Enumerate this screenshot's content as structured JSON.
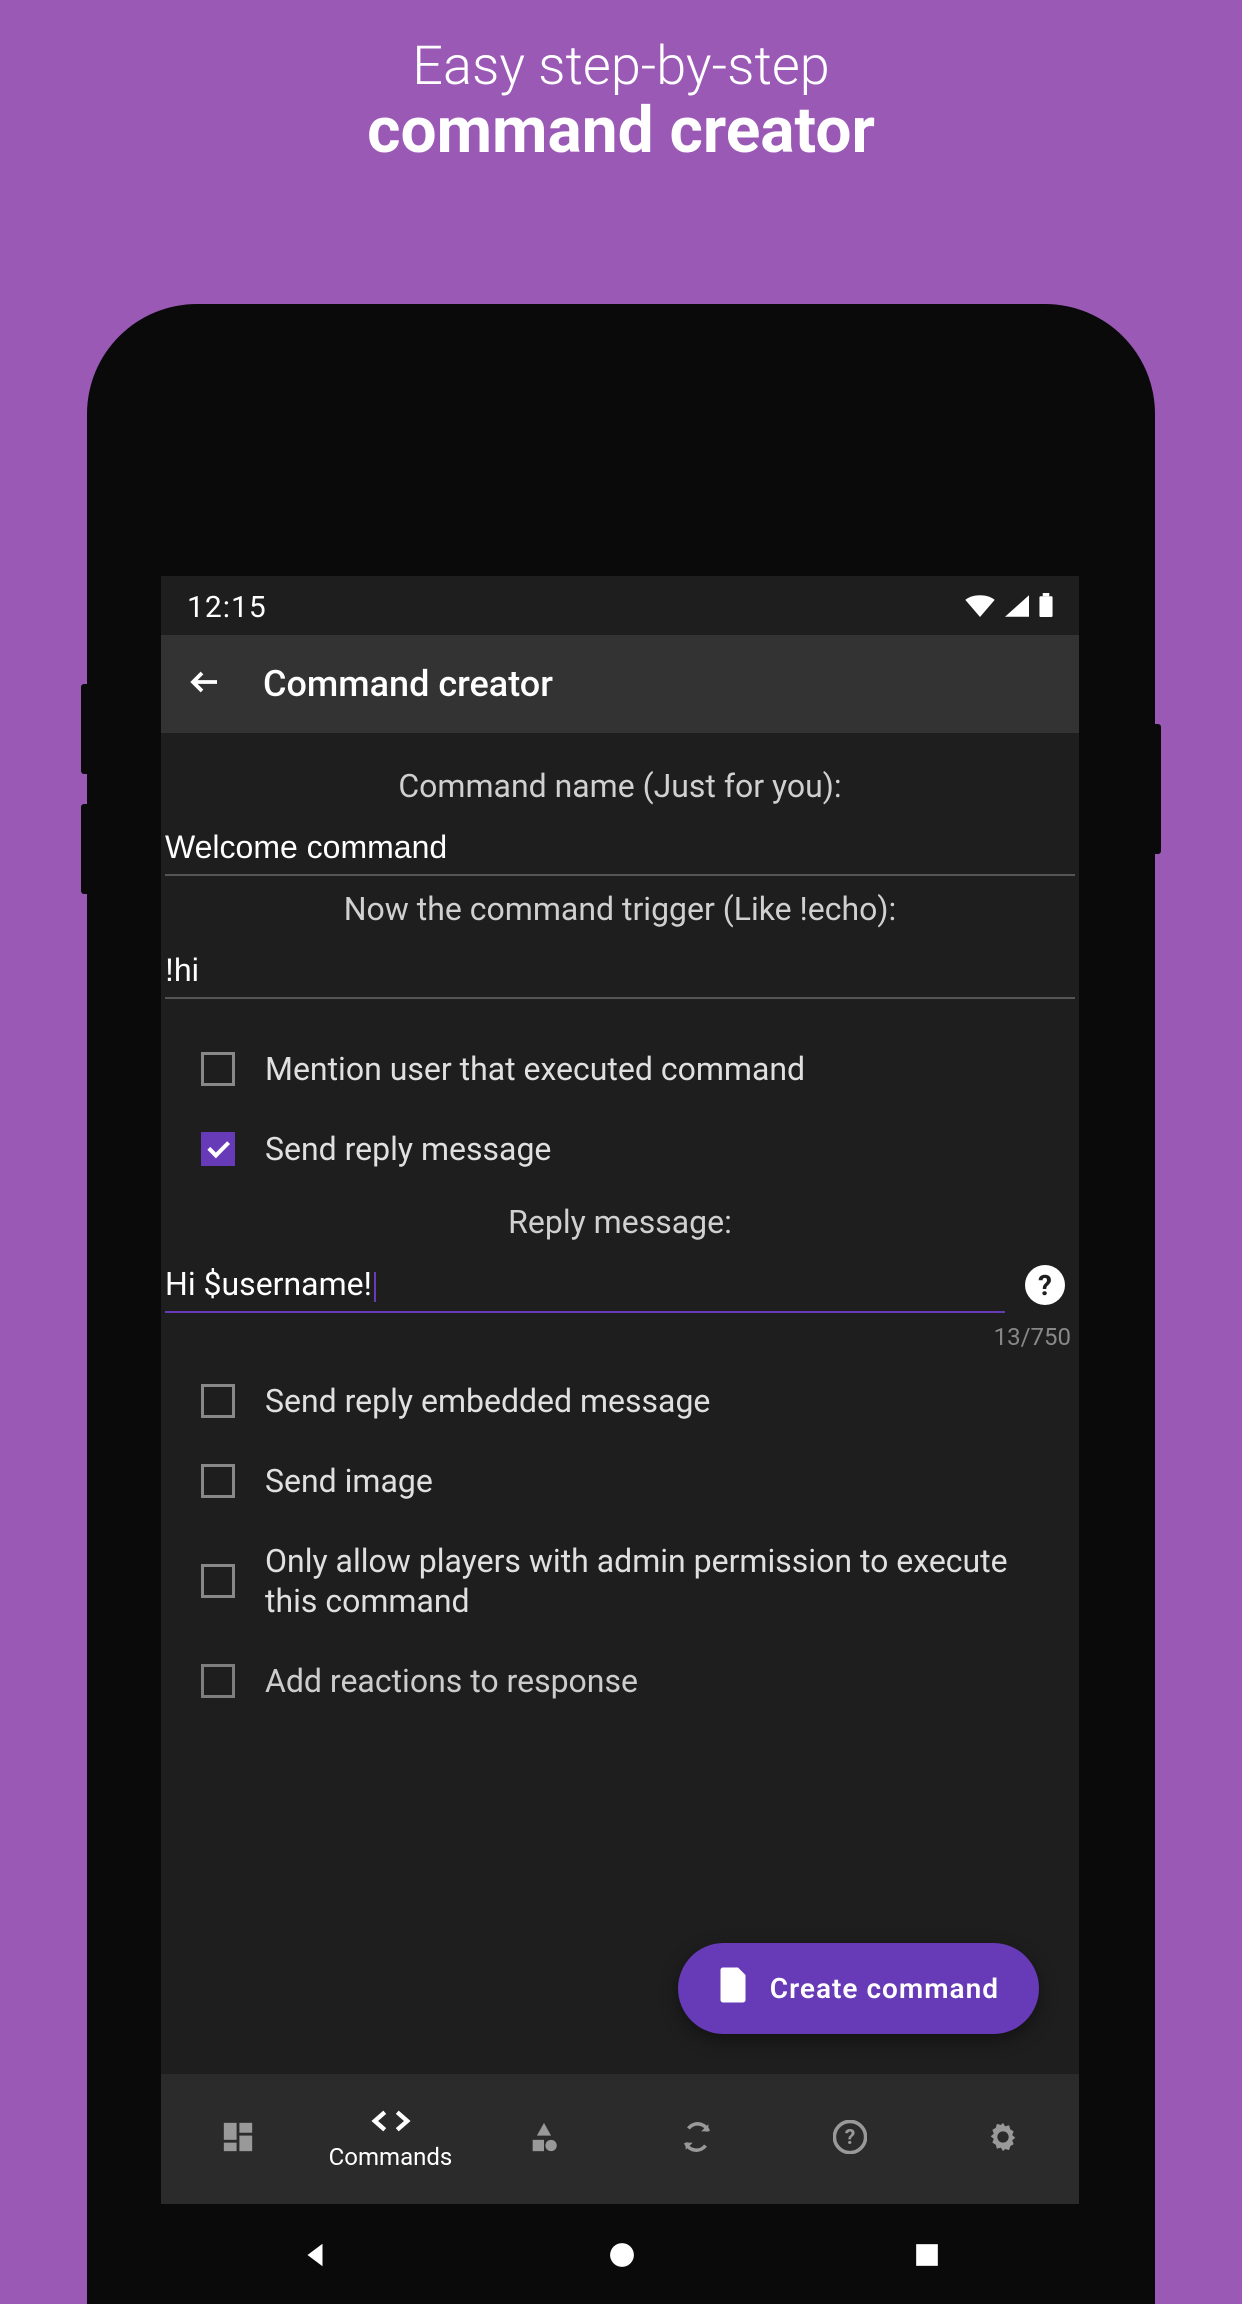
{
  "promo": {
    "line1": "Easy step-by-step",
    "line2": "command creator"
  },
  "statusBar": {
    "time": "12:15"
  },
  "appBar": {
    "title": "Command creator"
  },
  "form": {
    "nameLabel": "Command name (Just for you):",
    "nameValue": "Welcome command",
    "triggerLabel": "Now the command trigger (Like !echo):",
    "triggerValue": "!hi",
    "options": {
      "mention": {
        "label": "Mention user that executed command",
        "checked": false
      },
      "sendReply": {
        "label": "Send reply message",
        "checked": true
      },
      "sendEmbed": {
        "label": "Send reply embedded message",
        "checked": false
      },
      "sendImage": {
        "label": "Send image",
        "checked": false
      },
      "adminOnly": {
        "label": "Only allow players with admin permission to execute this command",
        "checked": false
      },
      "addReactions": {
        "label": "Add reactions to response",
        "checked": false
      }
    },
    "replyLabel": "Reply message:",
    "replyValue": "Hi $username!",
    "charCount": "13/750"
  },
  "fab": {
    "label": "Create command"
  },
  "bottomNav": {
    "items": [
      {
        "key": "dashboard",
        "label": ""
      },
      {
        "key": "commands",
        "label": "Commands"
      },
      {
        "key": "modules",
        "label": ""
      },
      {
        "key": "sync",
        "label": ""
      },
      {
        "key": "help",
        "label": ""
      },
      {
        "key": "settings",
        "label": ""
      }
    ],
    "activeIndex": 1
  }
}
